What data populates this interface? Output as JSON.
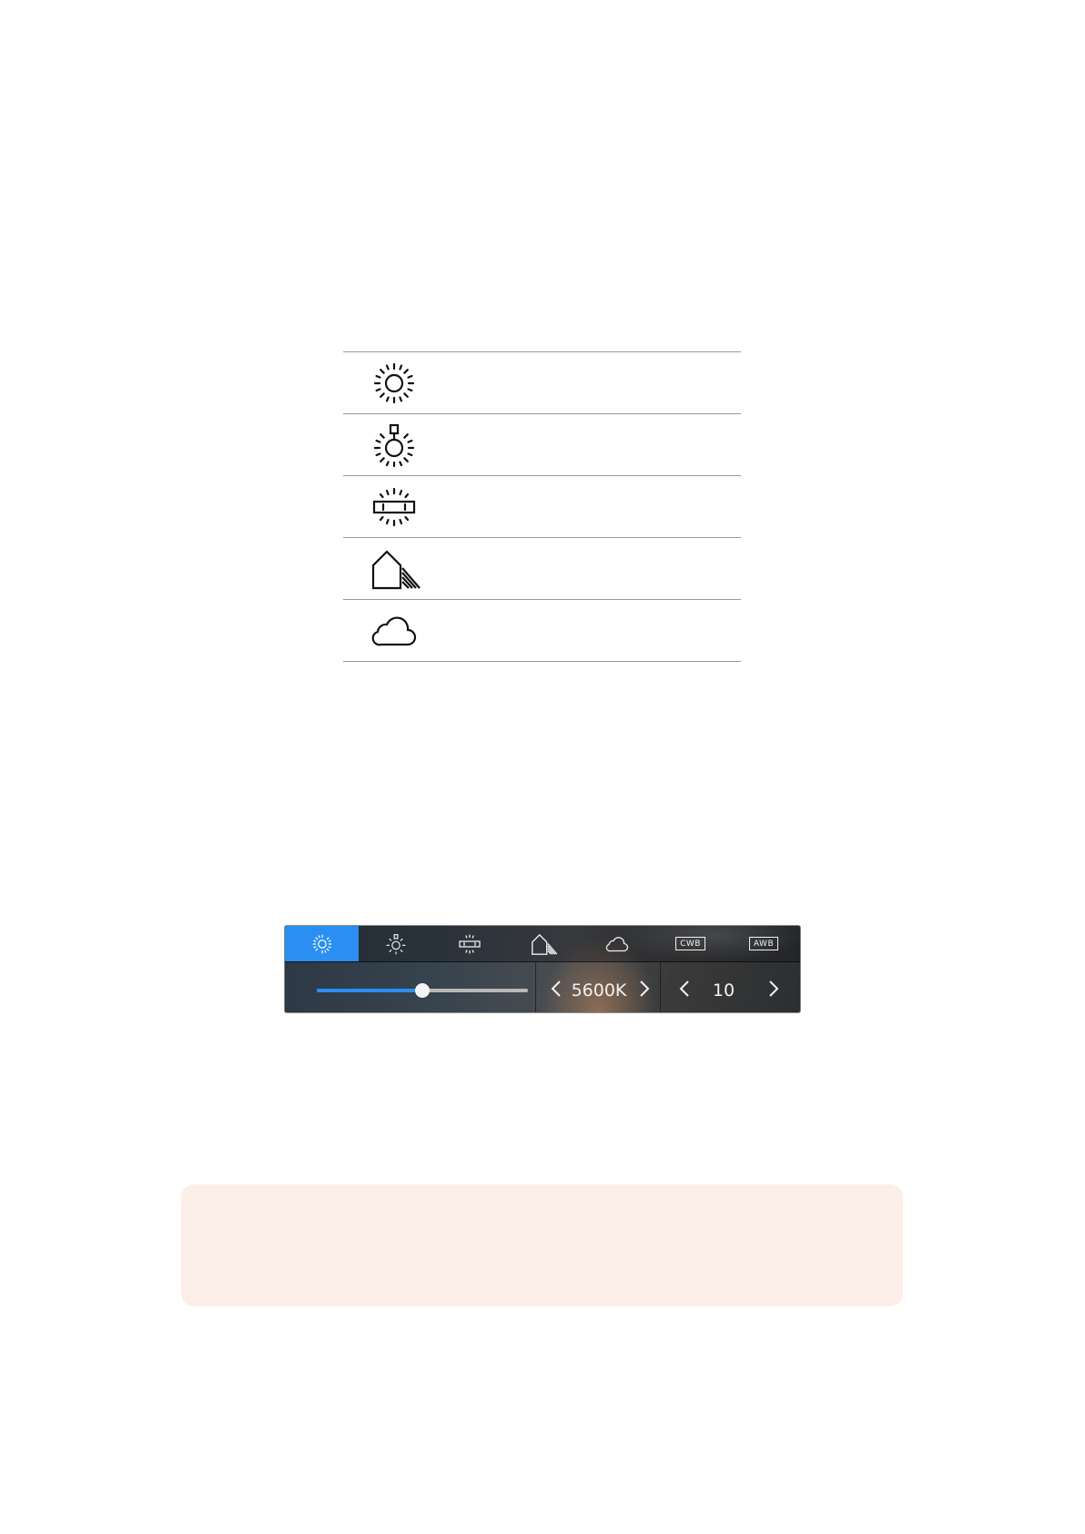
{
  "presets_table": {
    "rows": [
      {
        "icon": "sun-icon"
      },
      {
        "icon": "tungsten-bulb-icon"
      },
      {
        "icon": "fluorescent-icon"
      },
      {
        "icon": "shade-house-icon"
      },
      {
        "icon": "cloud-icon"
      }
    ]
  },
  "wb_panel": {
    "tabs": [
      {
        "icon": "sun-icon",
        "active": true
      },
      {
        "icon": "tungsten-bulb-icon",
        "active": false
      },
      {
        "icon": "fluorescent-icon",
        "active": false
      },
      {
        "icon": "shade-house-icon",
        "active": false
      },
      {
        "icon": "cloud-icon",
        "active": false
      },
      {
        "icon": "cwb-badge-icon",
        "label": "CWB",
        "active": false
      },
      {
        "icon": "awb-badge-icon",
        "label": "AWB",
        "active": false
      }
    ],
    "white_balance_value": "5600K",
    "slider_level": 0.5,
    "tint_value": "10",
    "colors": {
      "accent": "#2a8ff0",
      "track": "#b8b8b8",
      "thumb": "#f4f4f4"
    }
  }
}
